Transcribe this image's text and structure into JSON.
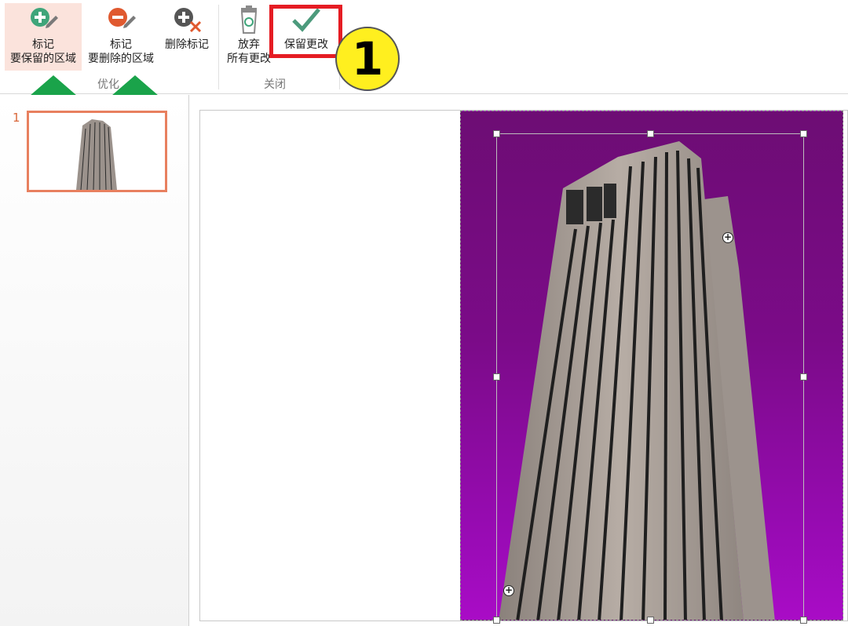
{
  "ribbon": {
    "mark_keep": {
      "line1": "标记",
      "line2": "要保留的区域"
    },
    "mark_remove": {
      "line1": "标记",
      "line2": "要删除的区域"
    },
    "delete_mark": {
      "label": "删除标记"
    },
    "discard_all": {
      "line1": "放弃",
      "line2": "所有更改"
    },
    "keep_changes": {
      "label": "保留更改"
    },
    "groups": {
      "refine": "优化",
      "close": "关闭"
    }
  },
  "callout": {
    "number": "1"
  },
  "slides": {
    "items": [
      {
        "number": "1"
      }
    ]
  },
  "colors": {
    "accent_red": "#e51c23",
    "callout_yellow": "#ffef1f",
    "arrow_green": "#1aa34a",
    "removal_purple": "#8a0aa0",
    "thumb_border": "#e8805f"
  },
  "icons": {
    "mark_keep": "plus-pencil-icon",
    "mark_remove": "minus-pencil-icon",
    "delete_mark": "delete-mark-icon",
    "discard_all": "recycle-bin-icon",
    "keep_changes": "checkmark-icon"
  }
}
